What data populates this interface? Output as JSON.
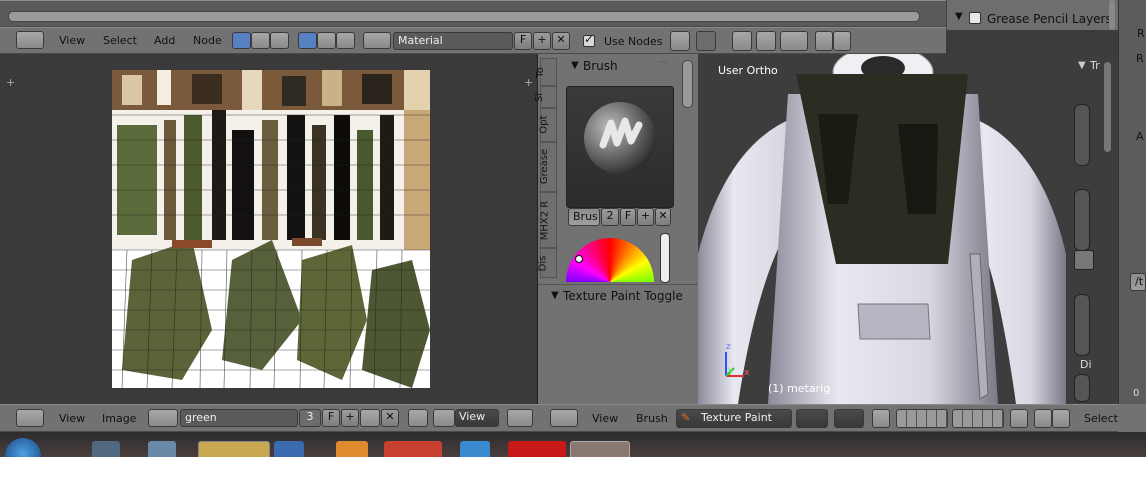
{
  "top_right_panel": {
    "layer_label": "Grease Pencil Layers",
    "far_right_label": "R"
  },
  "node_header": {
    "menu": [
      "View",
      "Select",
      "Add",
      "Node"
    ],
    "material_field": "Material",
    "fake_user": "F",
    "use_nodes_label": "Use Nodes"
  },
  "uv_editor": {
    "menu": [
      "View",
      "Image"
    ],
    "image_name": "green",
    "users": "3",
    "fake_user": "F",
    "view_button": "View"
  },
  "tool_shelf": {
    "tabs": [
      "To",
      "Sl",
      "Opt",
      "Grease",
      "MHX2 R",
      "Dis"
    ],
    "brush_panel_title": "Brush",
    "brush_name": "Brus",
    "brush_users": "2",
    "brush_fake": "F",
    "texture_toggle_title": "Texture Paint Toggle"
  },
  "viewport": {
    "view_label": "User Ortho",
    "object_label": "(1) metarig",
    "axis_z": "z",
    "axis_y": "y",
    "axis_x": "x",
    "properties_title": "Tr",
    "di_label": "Di"
  },
  "viewport_header": {
    "menu": [
      "View",
      "Brush"
    ],
    "mode": "Texture Paint",
    "selection_label": "Selecti"
  },
  "right_edge": {
    "labels": [
      "R",
      "A",
      "/t",
      "0"
    ]
  },
  "colors": {
    "header": "#727272",
    "viewport_bg": "#3d3d3d",
    "uv_bg": "#3a3a3a",
    "accent_orange": "#e07020",
    "taskbar": "#3a3a3a"
  }
}
